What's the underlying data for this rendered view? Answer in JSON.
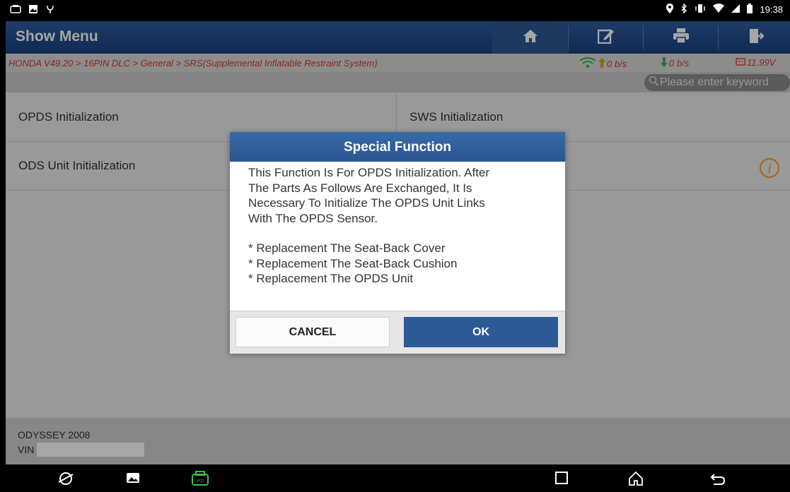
{
  "status_bar": {
    "time": "19:38"
  },
  "header": {
    "title": "Show Menu",
    "buttons": {
      "home": "home-icon",
      "edit": "edit-icon",
      "print": "print-icon",
      "exit": "exit-icon"
    }
  },
  "breadcrumb": {
    "path": "HONDA V49.20 > 16PIN DLC > General > SRS(Supplemental Inflatable Restraint System)",
    "upload": "0 b/s",
    "download": "0 b/s",
    "battery": "11.99V"
  },
  "search": {
    "placeholder": "Please enter keyword"
  },
  "menu": {
    "items": [
      {
        "label": "OPDS Initialization"
      },
      {
        "label": "SWS Initialization"
      },
      {
        "label": "ODS Unit Initialization"
      },
      {
        "label": ""
      }
    ]
  },
  "footer": {
    "model": "ODYSSEY 2008",
    "vin_label": "VIN"
  },
  "dialog": {
    "title": "Special Function",
    "lines": [
      "This Function Is For OPDS Initialization. After",
      "The Parts As Follows Are Exchanged, It Is",
      "Necessary To Initialize The OPDS Unit Links",
      "With The OPDS Sensor."
    ],
    "bullets": [
      "* Replacement The Seat-Back Cover",
      "* Replacement The Seat-Back Cushion",
      "* Replacement The OPDS Unit"
    ],
    "cancel_label": "CANCEL",
    "ok_label": "OK"
  },
  "colors": {
    "header": "#1f4a8a",
    "breadcrumb_text": "#d83a2a",
    "ok_button": "#2c5a97",
    "info_icon": "#f0a030"
  }
}
